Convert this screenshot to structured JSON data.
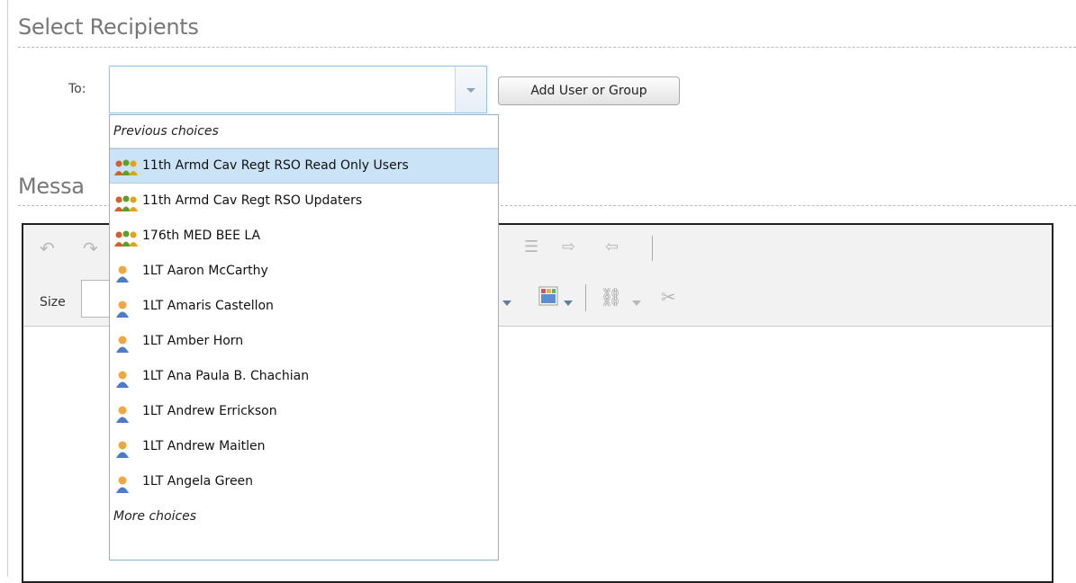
{
  "recipients": {
    "title": "Select Recipients",
    "to_label": "To:",
    "to_value": "",
    "add_button_label": "Add User or Group"
  },
  "message": {
    "title": "Messa"
  },
  "editor": {
    "size_label": "Size"
  },
  "dropdown": {
    "header": "Previous choices",
    "footer": "More choices",
    "items": [
      {
        "label": "11th Armd Cav Regt RSO Read Only Users",
        "type": "group",
        "selected": true
      },
      {
        "label": "11th Armd Cav Regt RSO Updaters",
        "type": "group",
        "selected": false
      },
      {
        "label": "176th MED BEE LA",
        "type": "group",
        "selected": false
      },
      {
        "label": "1LT Aaron McCarthy",
        "type": "user",
        "selected": false
      },
      {
        "label": "1LT Amaris Castellon",
        "type": "user",
        "selected": false
      },
      {
        "label": "1LT Amber Horn",
        "type": "user",
        "selected": false
      },
      {
        "label": "1LT Ana Paula B. Chachian",
        "type": "user",
        "selected": false
      },
      {
        "label": "1LT Andrew Errickson",
        "type": "user",
        "selected": false
      },
      {
        "label": "1LT Andrew Maitlen",
        "type": "user",
        "selected": false
      },
      {
        "label": "1LT Angela Green",
        "type": "user",
        "selected": false
      }
    ]
  },
  "colors": {
    "selection": "#cbe3f7",
    "combo_border": "#9ac6e8",
    "group_icon": "#e98a2b",
    "user_icon": "#f0a23a"
  }
}
